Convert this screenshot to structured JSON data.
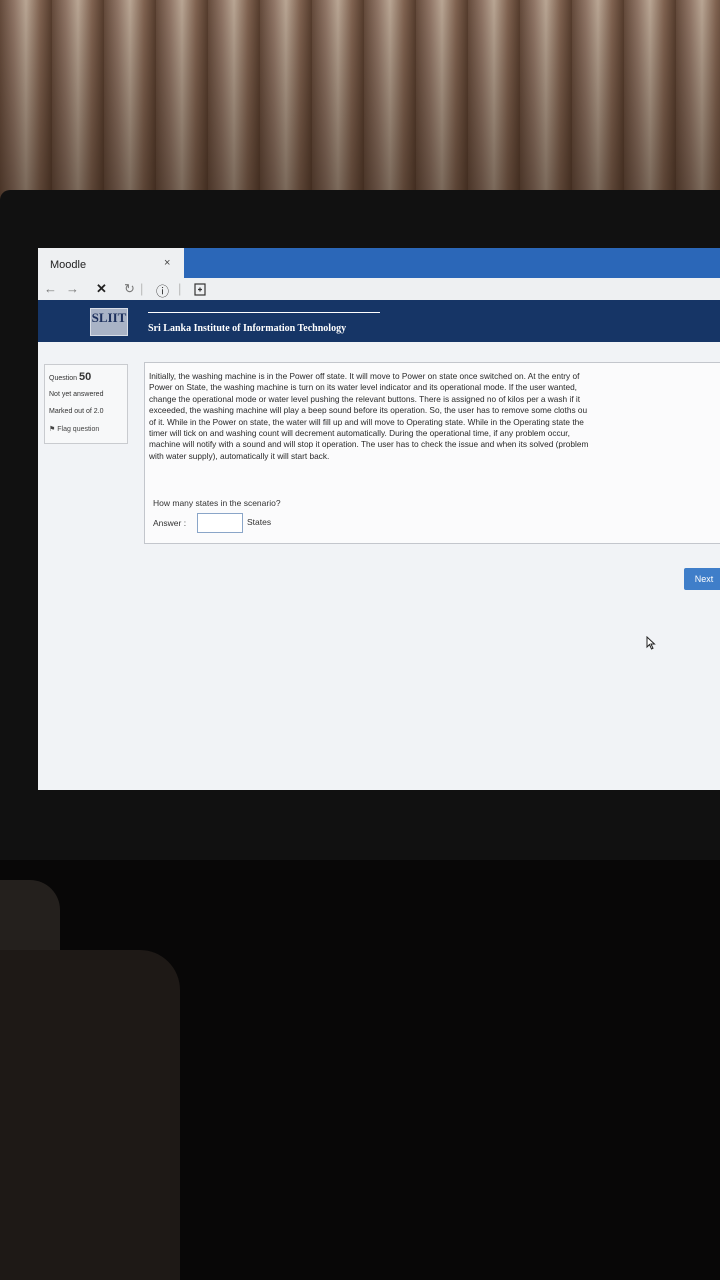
{
  "browser": {
    "tab_title": "Moodle",
    "tab_close": "×",
    "nav": {
      "back": "←",
      "forward": "→",
      "stop": "✕",
      "refresh": "↻",
      "info": "ⓘ"
    }
  },
  "header": {
    "logo_text": "SLIIT",
    "institute_name": "Sri Lanka Institute of Information Technology"
  },
  "question_info": {
    "label": "Question",
    "number": "50",
    "status": "Not yet answered",
    "marks": "Marked out of 2.0",
    "flag_label": "Flag question"
  },
  "question": {
    "lines": [
      "Initially, the washing machine is in the Power off state. It will move to Power on state once switched on. At the entry of",
      "Power on State, the washing machine is turn on its water level indicator and its operational mode. If the user wanted,",
      "change the operational mode or water level pushing the relevant buttons. There is assigned no of kilos per a wash if it",
      "exceeded, the washing machine will play a beep sound before its operation. So, the user has to remove some cloths ou",
      "of it. While in the Power on state, the water will fill up and will move to Operating state. While in the Operating state the",
      "timer will tick on and washing count will decrement automatically. During the operational time, if any problem occur,",
      "machine will notify with a sound and will stop it operation. The user has to check the issue and when its solved (problem",
      "with water supply), automatically it will start back."
    ],
    "prompt": "How many states in the scenario?",
    "answer_label": "Answer :",
    "answer_value": "",
    "answer_units": "States"
  },
  "navigation": {
    "next_label": "Next"
  }
}
